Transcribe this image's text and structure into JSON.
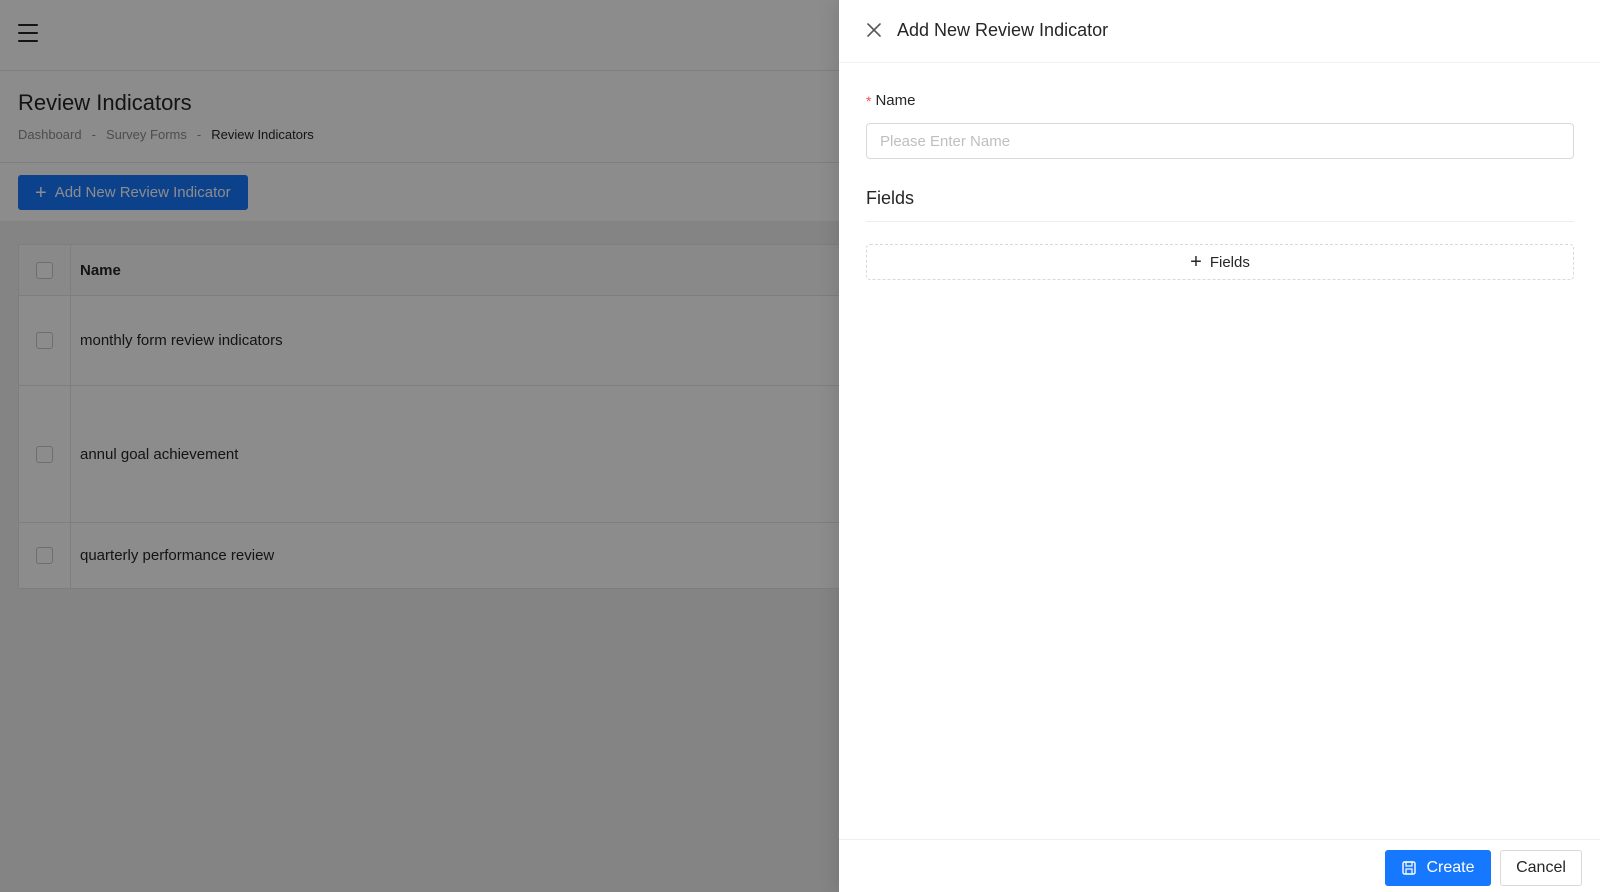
{
  "page": {
    "title": "Review Indicators",
    "breadcrumb": [
      "Dashboard",
      "Survey Forms",
      "Review Indicators"
    ],
    "breadcrumb_separator": "-",
    "add_button_label": "Add New Review Indicator",
    "table": {
      "column_name": "Name",
      "rows": [
        "monthly form review indicators",
        "annul goal achievement",
        "quarterly performance review"
      ]
    }
  },
  "drawer": {
    "title": "Add New Review Indicator",
    "name_label": "Name",
    "required_mark": "*",
    "name_placeholder": "Please Enter Name",
    "name_value": "",
    "fields_section_title": "Fields",
    "add_fields_label": "Fields",
    "create_label": "Create",
    "cancel_label": "Cancel"
  },
  "icons": {
    "menu": "hamburger-menu-icon",
    "add": "plus-icon",
    "close": "close-icon",
    "save": "save-icon"
  },
  "colors": {
    "primary": "#1677ff",
    "required": "#ff4d4f",
    "overlay": "rgba(0,0,0,0.45)"
  }
}
